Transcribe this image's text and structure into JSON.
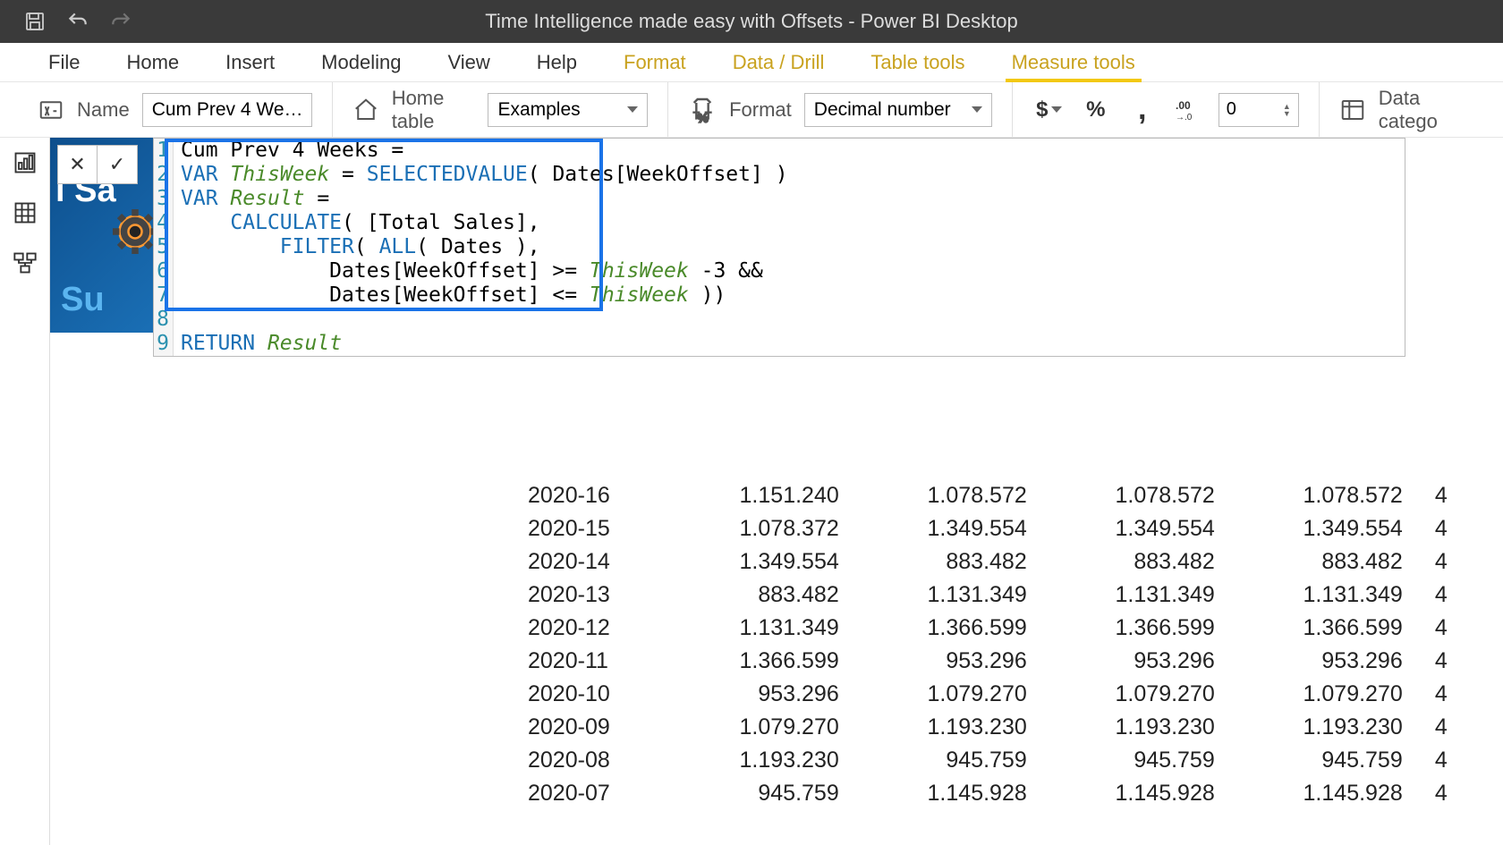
{
  "window_title": "Time Intelligence made easy with Offsets - Power BI Desktop",
  "tabs": {
    "file": "File",
    "home": "Home",
    "insert": "Insert",
    "modeling": "Modeling",
    "view": "View",
    "help": "Help",
    "format": "Format",
    "datadrill": "Data / Drill",
    "tabletools": "Table tools",
    "measuretools": "Measure tools"
  },
  "ribbon": {
    "name_label": "Name",
    "name_value": "Cum Prev 4 We…",
    "hometable_label": "Home table",
    "hometable_value": "Examples",
    "format_label": "Format",
    "format_value": "Decimal number",
    "decimals": "0",
    "datacat_label": "Data catego"
  },
  "formula": {
    "lines": [
      {
        "n": "1",
        "code": "Cum Prev 4 Weeks ="
      },
      {
        "n": "2",
        "code": "VAR ThisWeek = SELECTEDVALUE( Dates[WeekOffset] )"
      },
      {
        "n": "3",
        "code": "VAR Result ="
      },
      {
        "n": "4",
        "code": "    CALCULATE( [Total Sales],"
      },
      {
        "n": "5",
        "code": "        FILTER( ALL( Dates ),"
      },
      {
        "n": "6",
        "code": "            Dates[WeekOffset] >= ThisWeek -3 &&"
      },
      {
        "n": "7",
        "code": "            Dates[WeekOffset] <= ThisWeek ))"
      },
      {
        "n": "8",
        "code": ""
      },
      {
        "n": "9",
        "code": "RETURN Result"
      }
    ]
  },
  "bg_tile": {
    "line1": "l Sa",
    "line2": "Su"
  },
  "table_rows": [
    {
      "w": "2020-16",
      "c1": "1.151.240",
      "c2": "1.078.572",
      "c3": "1.078.572",
      "c4": "1.078.572"
    },
    {
      "w": "2020-15",
      "c1": "1.078.372",
      "c2": "1.349.554",
      "c3": "1.349.554",
      "c4": "1.349.554"
    },
    {
      "w": "2020-14",
      "c1": "1.349.554",
      "c2": "883.482",
      "c3": "883.482",
      "c4": "883.482"
    },
    {
      "w": "2020-13",
      "c1": "883.482",
      "c2": "1.131.349",
      "c3": "1.131.349",
      "c4": "1.131.349"
    },
    {
      "w": "2020-12",
      "c1": "1.131.349",
      "c2": "1.366.599",
      "c3": "1.366.599",
      "c4": "1.366.599"
    },
    {
      "w": "2020-11",
      "c1": "1.366.599",
      "c2": "953.296",
      "c3": "953.296",
      "c4": "953.296"
    },
    {
      "w": "2020-10",
      "c1": "953.296",
      "c2": "1.079.270",
      "c3": "1.079.270",
      "c4": "1.079.270"
    },
    {
      "w": "2020-09",
      "c1": "1.079.270",
      "c2": "1.193.230",
      "c3": "1.193.230",
      "c4": "1.193.230"
    },
    {
      "w": "2020-08",
      "c1": "1.193.230",
      "c2": "945.759",
      "c3": "945.759",
      "c4": "945.759"
    },
    {
      "w": "2020-07",
      "c1": "945.759",
      "c2": "1.145.928",
      "c3": "1.145.928",
      "c4": "1.145.928"
    }
  ],
  "table_trailing": "4"
}
